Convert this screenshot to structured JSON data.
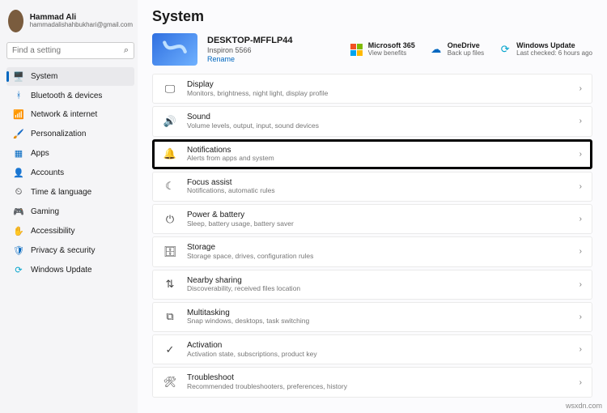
{
  "user": {
    "name": "Hammad Ali",
    "email": "hammadalishahbukhari@gmail.com"
  },
  "search": {
    "placeholder": "Find a setting"
  },
  "nav": [
    {
      "icon": "🖥️",
      "label": "System",
      "cls": "c-blue",
      "active": true
    },
    {
      "icon": "ᚼ",
      "label": "Bluetooth & devices",
      "cls": "c-blue"
    },
    {
      "icon": "📶",
      "label": "Network & internet",
      "cls": "c-blue"
    },
    {
      "icon": "🖌️",
      "label": "Personalization",
      "cls": "c-orange"
    },
    {
      "icon": "▦",
      "label": "Apps",
      "cls": "c-blue"
    },
    {
      "icon": "👤",
      "label": "Accounts",
      "cls": ""
    },
    {
      "icon": "⏲",
      "label": "Time & language",
      "cls": ""
    },
    {
      "icon": "🎮",
      "label": "Gaming",
      "cls": "c-green"
    },
    {
      "icon": "✋",
      "label": "Accessibility",
      "cls": "c-blue"
    },
    {
      "icon": "🛡",
      "label": "Privacy & security",
      "cls": "c-blue"
    },
    {
      "icon": "⟳",
      "label": "Windows Update",
      "cls": "c-cyan"
    }
  ],
  "page": {
    "title": "System"
  },
  "device": {
    "name": "DESKTOP-MFFLP44",
    "model": "Inspiron 5566",
    "rename": "Rename"
  },
  "status": {
    "m365": {
      "title": "Microsoft 365",
      "sub": "View benefits"
    },
    "onedrive": {
      "title": "OneDrive",
      "sub": "Back up files"
    },
    "update": {
      "title": "Windows Update",
      "sub": "Last checked: 6 hours ago"
    }
  },
  "cards": [
    {
      "icon": "🖵",
      "title": "Display",
      "sub": "Monitors, brightness, night light, display profile"
    },
    {
      "icon": "🔊",
      "title": "Sound",
      "sub": "Volume levels, output, input, sound devices"
    },
    {
      "icon": "🔔",
      "title": "Notifications",
      "sub": "Alerts from apps and system",
      "hl": true
    },
    {
      "icon": "☾",
      "title": "Focus assist",
      "sub": "Notifications, automatic rules"
    },
    {
      "icon": "⏻",
      "title": "Power & battery",
      "sub": "Sleep, battery usage, battery saver"
    },
    {
      "icon": "🗄",
      "title": "Storage",
      "sub": "Storage space, drives, configuration rules"
    },
    {
      "icon": "⇅",
      "title": "Nearby sharing",
      "sub": "Discoverability, received files location"
    },
    {
      "icon": "⧉",
      "title": "Multitasking",
      "sub": "Snap windows, desktops, task switching"
    },
    {
      "icon": "✓",
      "title": "Activation",
      "sub": "Activation state, subscriptions, product key"
    },
    {
      "icon": "🛠",
      "title": "Troubleshoot",
      "sub": "Recommended troubleshooters, preferences, history"
    }
  ],
  "watermark": "wsxdn.com"
}
